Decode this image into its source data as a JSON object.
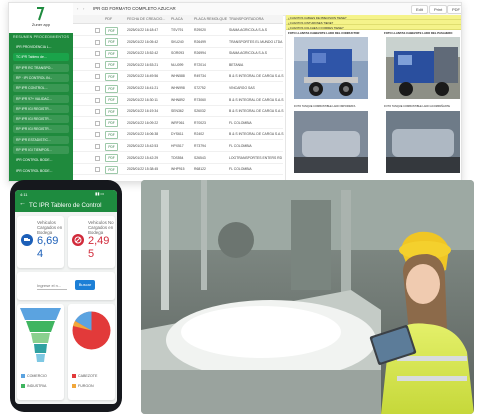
{
  "desktop": {
    "brand": "Zuner app",
    "section_header": "RESUMEN PROCEDIMIENTOS",
    "sidebar_items": [
      {
        "label": "IPR PROVIDENCIA L..."
      },
      {
        "label": "TC IPR Tablero de..."
      },
      {
        "label": "RP IPR RC TRANSPO..."
      },
      {
        "label": "RP · IPI CONTROL IN..."
      },
      {
        "label": "RP IPR CONTROL..."
      },
      {
        "label": "RP IPR 97+ VALIDAC..."
      },
      {
        "label": "RP IPR IGI REGISTR..."
      },
      {
        "label": "RP IPR IGI REGISTR..."
      },
      {
        "label": "RP IPR IGI REGISTR..."
      },
      {
        "label": "RP IPR ESTADISTIC..."
      },
      {
        "label": "RP IPR IGI TIEMPOS..."
      },
      {
        "label": "IPR CONTROL BODE..."
      },
      {
        "label": "IPR CONTROL BODE..."
      }
    ],
    "window_title": "IPR GD FORMATO COMPLETO AZUCAR",
    "buttons": {
      "edit": "Edit",
      "print": "Print",
      "pdf": "PDF"
    },
    "columns": [
      "PDF",
      "FECHA DE CREACIO...",
      "PLACA",
      "PLACA REMOLQUE",
      "TRANSPORTADORA"
    ],
    "rows": [
      {
        "pdf": "PDF",
        "date": "2025/01/22 16:18:47",
        "placa": "TSV791",
        "remolque": "R29020",
        "transp": "SIAMA AGRICOLA S.A.S"
      },
      {
        "pdf": "PDF",
        "date": "2025/01/22 16:05:42",
        "placa": "SKU240",
        "remolque": "R26499",
        "transp": "TRANSPORTES EL MUNDO LTDA"
      },
      {
        "pdf": "PDF",
        "date": "2025/01/22 15:52:42",
        "placa": "SOR093",
        "remolque": "R26994",
        "transp": "SIAMA AGRICOLA S.A.S"
      },
      {
        "pdf": "PDF",
        "date": "2025/01/22 16:53:21",
        "placa": "NLU099",
        "remolque": "R72014",
        "transp": "BETANIA"
      },
      {
        "pdf": "PDF",
        "date": "2025/01/22 16:49:56",
        "placa": "WHN588",
        "remolque": "R49734",
        "transp": "B & S INTEGRAL DE CARGA S.A.S"
      },
      {
        "pdf": "PDF",
        "date": "2025/01/22 16:41:21",
        "placa": "WHN998",
        "remolque": "S72752",
        "transp": "VINCARGO SAS"
      },
      {
        "pdf": "PDF",
        "date": "2025/01/22 16:30:11",
        "placa": "WHN892",
        "remolque": "R73060",
        "transp": "B & S INTEGRAL DE CARGA S.A.S"
      },
      {
        "pdf": "PDF",
        "date": "2025/01/22 16:19:34",
        "placa": "SEN362",
        "remolque": "S26032",
        "transp": "B & S INTEGRAL DE CARGA S.A.S"
      },
      {
        "pdf": "PDF",
        "date": "2025/01/22 16:09:22",
        "placa": "WRF061",
        "remolque": "R70023",
        "transp": "FL COLOMBIA"
      },
      {
        "pdf": "PDF",
        "date": "2025/01/22 16:06:38",
        "placa": "DYS611",
        "remolque": "R2402",
        "transp": "B & S INTEGRAL DE CARGA S.A.S"
      },
      {
        "pdf": "PDF",
        "date": "2025/01/22 15:42:53",
        "placa": "HPX517",
        "remolque": "R73794",
        "transp": "FL COLOMBIA"
      },
      {
        "pdf": "PDF",
        "date": "2025/01/22 15:42:29",
        "placa": "TDS554",
        "remolque": "S26543",
        "transp": "LOGTRANSPORTES ENTERS RD"
      },
      {
        "pdf": "PDF",
        "date": "2025/01/22 15:38:45",
        "placa": "WHP915",
        "remolque": "R68122",
        "transp": "FL COLOMBIA"
      }
    ],
    "photo_headers": [
      "¿CUANTOS CABLES DE PRECISION TIENE?",
      "¿CUANTOS CINTURONES TIENE?",
      "¿CUANTOS COLCHES O FORRES TIENE?",
      "FOTO LLANTAS CABEZOTE LADO DEL CONDUCTOR"
    ],
    "photo_header_right": "FOTO LLANTAS CABEZOTE LADO DEL PASAJERO",
    "photo_caption_left": "FOTO TANQUE COMBUSTIBLE LADO IMPORRATA",
    "photo_caption_right": "FOTO TANQUE COMBUSTIBLE LADO ACOMPAÑANTE"
  },
  "phone": {
    "time": "4:11",
    "title": "TC IPR Tablero de Control",
    "kpi_left": {
      "label": "Vehiculos Cargados en Bodega",
      "value": "6,69",
      "sub": "4",
      "color": "#1c5fb8"
    },
    "kpi_right": {
      "label": "Vehiculos No Cargados en Bodega",
      "value": "2,49",
      "sub": "5",
      "color": "#d12a3a"
    },
    "search_placeholder": "Ingrese el n...",
    "search_button": "Buscar",
    "legend": [
      {
        "label": "COMERCIO",
        "color": "#5ba3e0"
      },
      {
        "label": "INDUSTRIA",
        "color": "#3fb560"
      },
      {
        "label": "CABEZOTE",
        "color": "#e23a3a"
      },
      {
        "label": "FURGON",
        "color": "#f1a73b"
      }
    ]
  },
  "colors": {
    "brand_green": "#1e8b3f",
    "accent_blue": "#1c5fb8",
    "accent_red": "#d12a3a"
  }
}
